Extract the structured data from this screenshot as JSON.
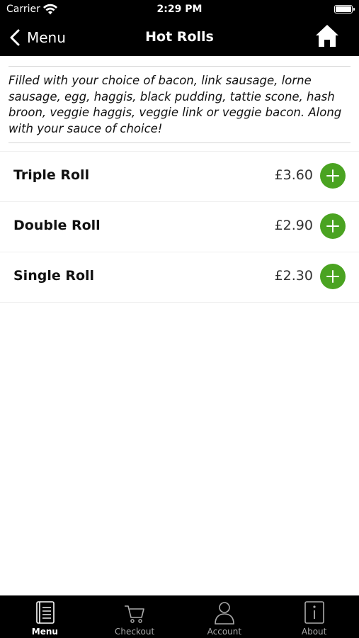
{
  "status": {
    "carrier": "Carrier",
    "time": "2:29 PM"
  },
  "nav": {
    "back_label": "Menu",
    "title": "Hot Rolls"
  },
  "description": "Filled with your choice of bacon, link sausage, lorne sausage, egg, haggis, black pudding, tattie scone, hash broon, veggie haggis, veggie link or veggie bacon. Along with your sauce of choice!",
  "items": [
    {
      "name": "Triple Roll",
      "price": "£3.60"
    },
    {
      "name": "Double Roll",
      "price": "£2.90"
    },
    {
      "name": "Single Roll",
      "price": "£2.30"
    }
  ],
  "tabs": [
    {
      "label": "Menu",
      "icon": "menu-book-icon",
      "active": true
    },
    {
      "label": "Checkout",
      "icon": "cart-icon",
      "active": false
    },
    {
      "label": "Account",
      "icon": "person-icon",
      "active": false
    },
    {
      "label": "About",
      "icon": "info-icon",
      "active": false
    }
  ],
  "colors": {
    "accent": "#4aa321",
    "bar": "#000000"
  }
}
